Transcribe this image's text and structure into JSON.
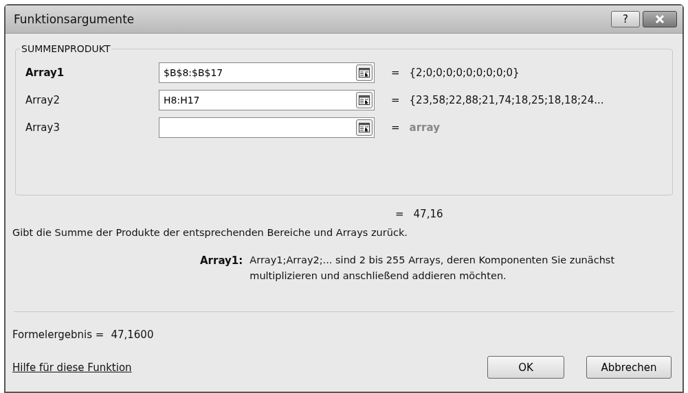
{
  "window": {
    "title": "Funktionsargumente",
    "help_button": "?"
  },
  "function_group": {
    "name": "SUMMENPRODUKT",
    "arguments": [
      {
        "label": "Array1",
        "value": "$B$8:$B$17",
        "result": "{2;0;0;0;0;0;0;0;0;0}",
        "selected": true,
        "result_muted": false
      },
      {
        "label": "Array2",
        "value": "H8:H17",
        "result": "{23,58;22,88;21,74;18,25;18,18;24...",
        "selected": false,
        "result_muted": false
      },
      {
        "label": "Array3",
        "result": "array",
        "selected": false,
        "result_muted": true
      }
    ]
  },
  "equals": "=",
  "function_result": "47,16",
  "description": "Gibt die Summe der Produkte der entsprechenden Bereiche und Arrays zurück.",
  "argument_help": {
    "label": "Array1:",
    "text": "Array1;Array2;... sind 2 bis 255 Arrays, deren Komponenten Sie zunächst multiplizieren und anschließend addieren möchten."
  },
  "formula_result": {
    "label": "Formelergebnis =",
    "value": "47,1600"
  },
  "help_link": "Hilfe für diese Funktion",
  "buttons": [
    "OK",
    "Abbrechen"
  ]
}
